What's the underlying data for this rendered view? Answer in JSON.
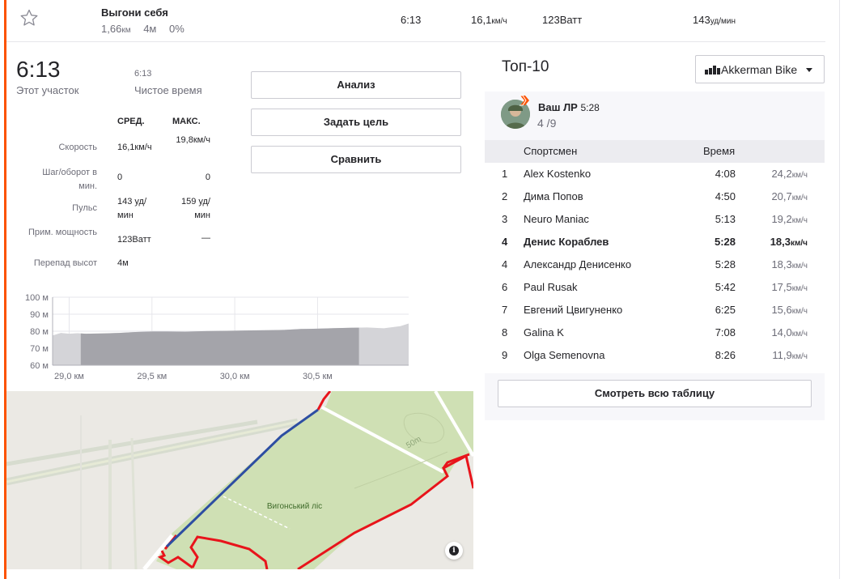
{
  "segment": {
    "name": "Выгони себя",
    "distance": "1,66",
    "distance_unit": "км",
    "elevation": "4м",
    "grade": "0%"
  },
  "header_stats": {
    "time": "6:13",
    "speed": "16,1",
    "speed_unit": "км/ч",
    "power": "123Ватт",
    "hr": "143",
    "hr_unit": "уд/мин"
  },
  "effort": {
    "time": "6:13",
    "time_label": "Этот участок",
    "moving_time": "6:13",
    "moving_label": "Чистое время"
  },
  "stats_table": {
    "col_avg": "СРЕД.",
    "col_max": "МАКС.",
    "rows": [
      {
        "label": "Скорость",
        "avg": "16,1км/ч",
        "max": "19,8км/ч"
      },
      {
        "label": "Шаг/оборот в мин.",
        "avg": "0",
        "max": "0"
      },
      {
        "label": "Пульс",
        "avg": "143 уд/мин",
        "max": "159 уд/мин"
      },
      {
        "label": "Прим. мощность",
        "avg": "123Ватт",
        "max": "—"
      },
      {
        "label": "Перепад высот",
        "avg": "4м",
        "max": ""
      }
    ]
  },
  "actions": {
    "analyze": "Анализ",
    "set_goal": "Задать цель",
    "compare": "Сравнить"
  },
  "chart_data": {
    "type": "area",
    "title": "",
    "xlabel": "",
    "ylabel": "",
    "y_ticks": [
      "100 м",
      "90 м",
      "80 м",
      "70 м",
      "60 м"
    ],
    "ylim": [
      60,
      100
    ],
    "x_ticks": [
      "29,0 км",
      "29,5 км",
      "30,0 км",
      "30,5 км"
    ],
    "x_tick_values": [
      29.0,
      29.5,
      30.0,
      30.5
    ],
    "xlim": [
      28.9,
      31.05
    ],
    "segment_range": [
      29.07,
      30.75
    ],
    "x": [
      28.9,
      28.95,
      29.0,
      29.05,
      29.1,
      29.2,
      29.3,
      29.4,
      29.5,
      29.6,
      29.7,
      29.8,
      29.9,
      30.0,
      30.1,
      30.2,
      30.3,
      30.4,
      30.5,
      30.6,
      30.7,
      30.8,
      30.9,
      31.0,
      31.05
    ],
    "y": [
      77.5,
      79.0,
      78.5,
      78.8,
      78.5,
      78.7,
      79.0,
      79.5,
      79.8,
      79.8,
      79.7,
      80.0,
      80.2,
      80.3,
      80.5,
      80.6,
      80.8,
      81.3,
      81.5,
      81.8,
      82.0,
      82.2,
      81.7,
      83.0,
      84.5
    ],
    "grid": true
  },
  "map": {
    "place_label": "Вигонський ліс",
    "contour_label": "50m",
    "info_icon": "info-icon"
  },
  "leaderboard": {
    "title": "Топ-10",
    "filter": "Akkerman Bike",
    "pr_label": "Ваш ЛР",
    "pr_time": "5:28",
    "pr_rank": "4 /9",
    "col_athlete": "Спортсмен",
    "col_time": "Время",
    "speed_unit": "км/ч",
    "rows": [
      {
        "rank": "1",
        "name": "Alex Kostenko",
        "time": "4:08",
        "speed": "24,2"
      },
      {
        "rank": "2",
        "name": "Дима Попов",
        "time": "4:50",
        "speed": "20,7"
      },
      {
        "rank": "3",
        "name": "Neuro Maniac",
        "time": "5:13",
        "speed": "19,2"
      },
      {
        "rank": "4",
        "name": "Денис Кораблев",
        "time": "5:28",
        "speed": "18,3"
      },
      {
        "rank": "4",
        "name": "Александр Денисенко",
        "time": "5:28",
        "speed": "18,3"
      },
      {
        "rank": "6",
        "name": "Paul Rusak",
        "time": "5:42",
        "speed": "17,5"
      },
      {
        "rank": "7",
        "name": "Евгений Цвигуненко",
        "time": "6:25",
        "speed": "15,6"
      },
      {
        "rank": "8",
        "name": "Galina K",
        "time": "7:08",
        "speed": "14,0"
      },
      {
        "rank": "9",
        "name": "Olga Semenovna",
        "time": "8:26",
        "speed": "11,9"
      }
    ],
    "highlight_index": 3,
    "view_all": "Смотреть всю таблицу"
  },
  "colors": {
    "accent": "#fc5200",
    "route_red": "#e8141b",
    "route_blue": "#2d4ea2",
    "forest": "#cfe0b4"
  }
}
